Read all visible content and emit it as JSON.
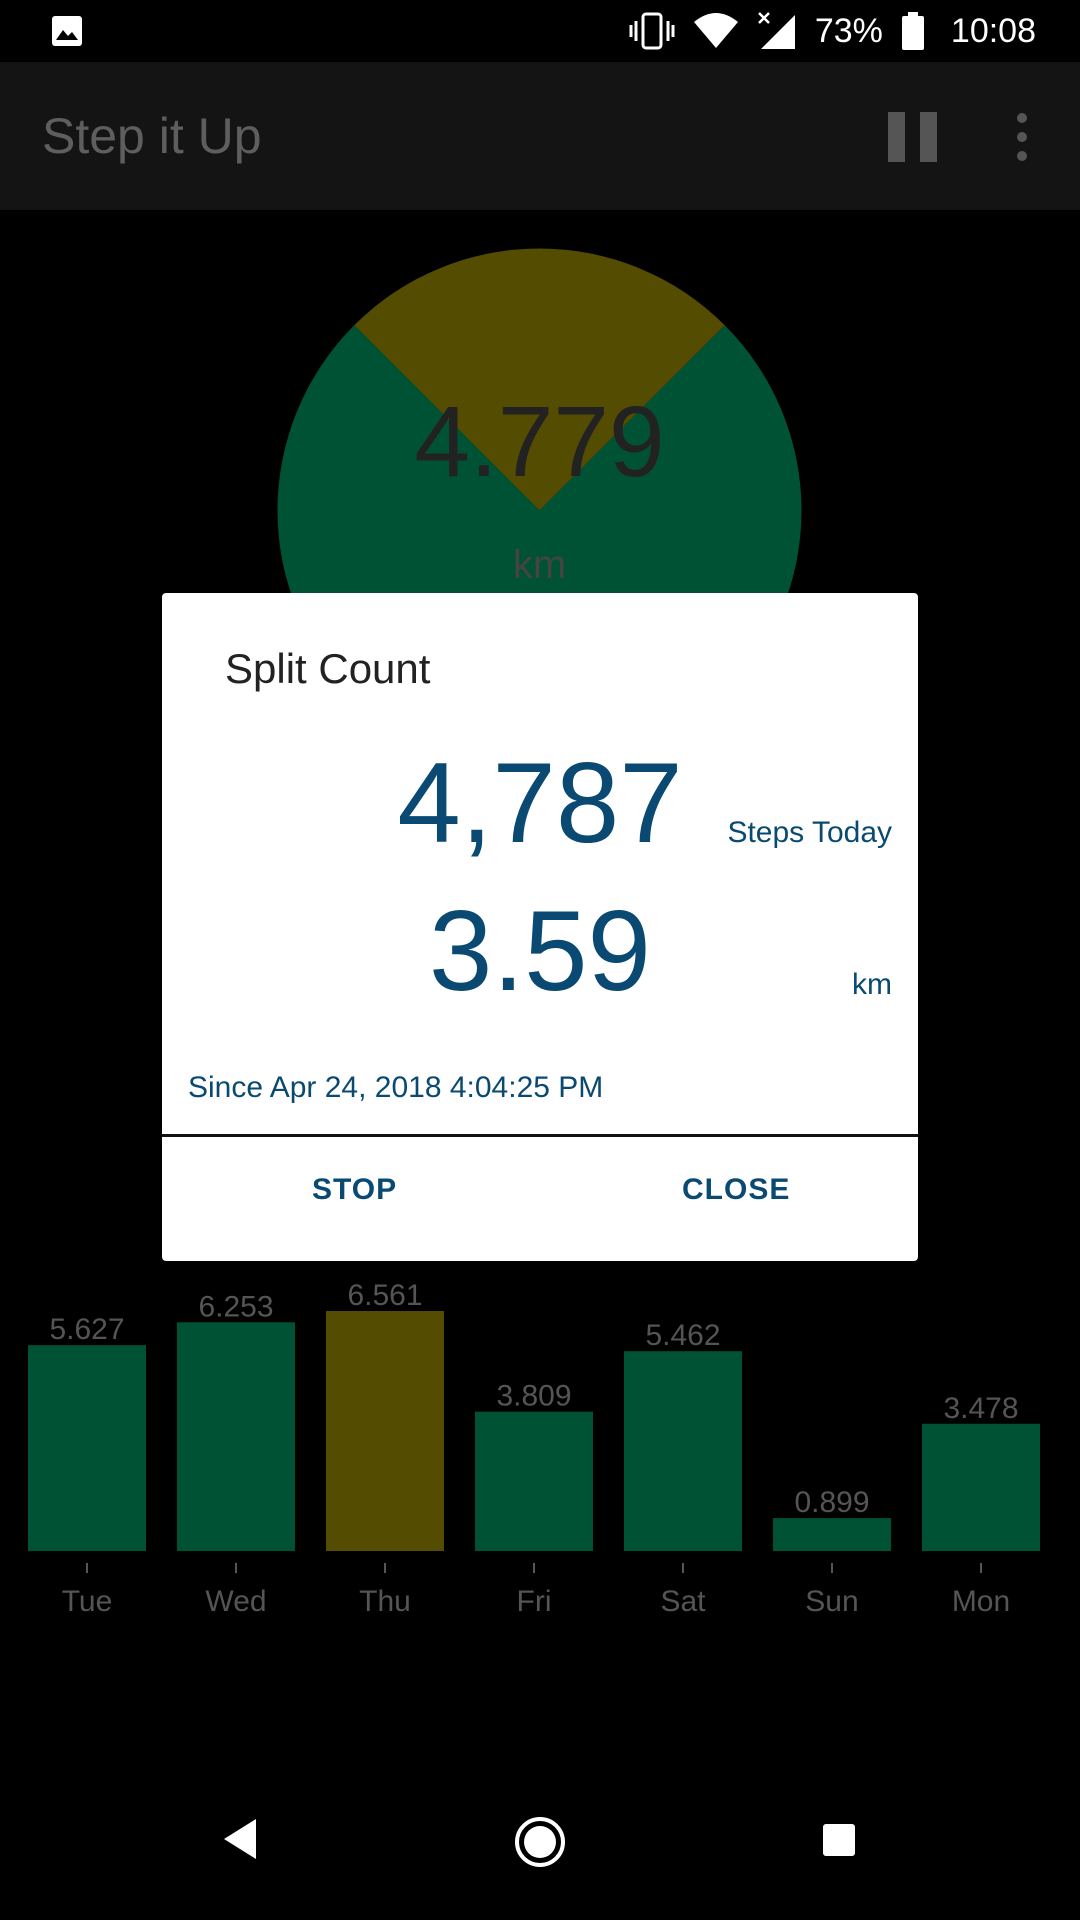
{
  "status_bar": {
    "battery_percent": "73%",
    "time": "10:08",
    "icons": [
      "image-icon",
      "vibrate-icon",
      "wifi-icon",
      "signal-icon",
      "battery-icon"
    ]
  },
  "app_bar": {
    "title": "Step it Up",
    "icons": [
      "pause-icon",
      "overflow-menu-icon"
    ]
  },
  "pie": {
    "value": "4.779",
    "unit": "km",
    "slices": [
      {
        "fraction": 0.25,
        "color": "#544c00"
      },
      {
        "fraction": 0.75,
        "color": "#005234"
      }
    ]
  },
  "dialog": {
    "title": "Split Count",
    "steps_value": "4,787",
    "steps_label": "Steps Today",
    "distance_value": "3.59",
    "distance_label": "km",
    "since": "Since Apr 24, 2018 4:04:25 PM",
    "buttons": {
      "stop": "STOP",
      "close": "CLOSE"
    }
  },
  "chart_data": {
    "type": "bar",
    "categories": [
      "Tue",
      "Wed",
      "Thu",
      "Fri",
      "Sat",
      "Sun",
      "Mon"
    ],
    "values": [
      5.627,
      6.253,
      6.561,
      3.809,
      5.462,
      0.899,
      3.478
    ],
    "value_labels": [
      "5.627",
      "6.253",
      "6.561",
      "3.809",
      "5.462",
      "0.899",
      "3.478"
    ],
    "highlight_index": 2,
    "colors": {
      "normal": "#005234",
      "highlight": "#544c00",
      "label": "#555555"
    }
  },
  "nav_bar": {
    "icons": [
      "back-icon",
      "home-icon",
      "recents-icon"
    ]
  }
}
